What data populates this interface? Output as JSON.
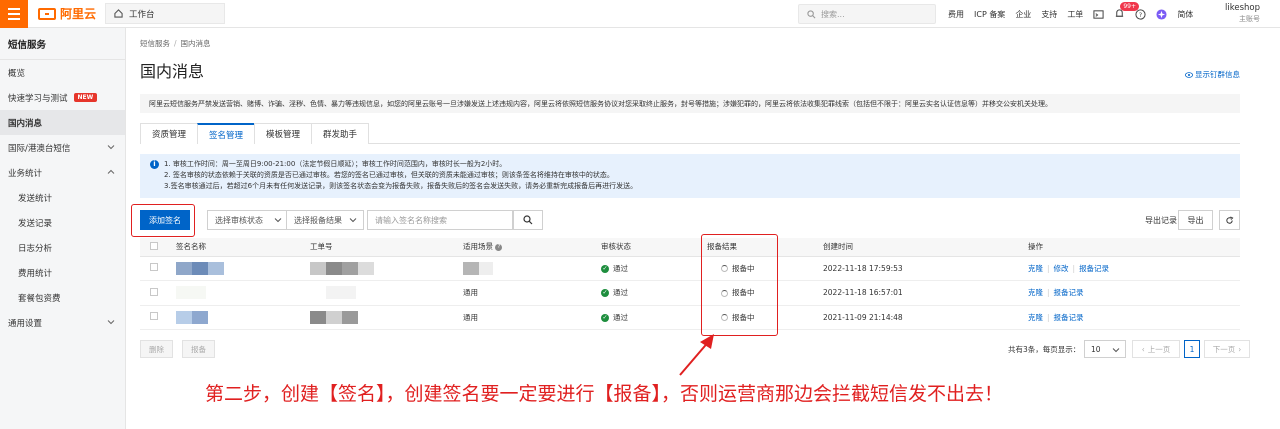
{
  "topbar": {
    "brand": "阿里云",
    "workbench": "工作台",
    "search_placeholder": "搜索...",
    "nav": [
      "费用",
      "ICP 备案",
      "企业",
      "支持",
      "工单"
    ],
    "notification_count": "99+",
    "language": "简体",
    "username": "likeshop",
    "account_type": "主账号"
  },
  "sidebar": {
    "title": "短信服务",
    "items": [
      {
        "label": "概览"
      },
      {
        "label": "快速学习与测试",
        "badge": "NEW"
      },
      {
        "label": "国内消息"
      },
      {
        "label": "国际/港澳台短信"
      },
      {
        "label": "业务统计"
      },
      {
        "label": "发送统计"
      },
      {
        "label": "发送记录"
      },
      {
        "label": "日志分析"
      },
      {
        "label": "费用统计"
      },
      {
        "label": "套餐包资费"
      },
      {
        "label": "通用设置"
      }
    ]
  },
  "breadcrumb": [
    "短信服务",
    "国内消息"
  ],
  "page_title": "国内消息",
  "help_link": "显示钉群信息",
  "notice": "阿里云短信服务严禁发送营销、赌博、诈骗、淫秽、色情、暴力等违规信息，如您的阿里云账号一旦涉嫌发送上述违规内容，阿里云将依照短信服务协议对您采取终止服务，封号等措施；涉嫌犯罪的，阿里云将依法收集犯罪线索（包括但不限于：阿里云实名认证信息等）并移交公安机关处理。",
  "tabs": [
    "资质管理",
    "签名管理",
    "模板管理",
    "群发助手"
  ],
  "info_lines": [
    "1. 审核工作时间：周一至周日9:00-21:00（法定节假日顺延）；审核工作时间范围内，审核时长一般为2小时。",
    "2. 签名审核的状态依赖于关联的资质是否已通过审核。若您的签名已通过审核，但关联的资质未能通过审核；则该条签名将维持在审核中的状态。",
    "3.签名审核通过后，若超过6个月未有任何发送记录，则该签名状态会变为报备失败，报备失败后的签名会发送失败，请务必重新完成报备后再进行发送。"
  ],
  "toolbar": {
    "add_button": "添加签名",
    "audit_filter": "选择审核状态",
    "report_filter": "选择报备结果",
    "search_placeholder": "请输入签名名称搜索",
    "export_records": "导出记录",
    "export_button": "导出"
  },
  "table": {
    "columns": [
      "签名名称",
      "工单号",
      "适用场景",
      "审核状态",
      "报备结果",
      "创建时间",
      "操作"
    ],
    "rows": [
      {
        "scene": "",
        "status": "通过",
        "report": "报备中",
        "created": "2022-11-18 17:59:53",
        "actions": [
          "克隆",
          "修改",
          "报备记录"
        ]
      },
      {
        "scene": "通用",
        "status": "通过",
        "report": "报备中",
        "created": "2022-11-18 16:57:01",
        "actions": [
          "克隆",
          "报备记录"
        ]
      },
      {
        "scene": "通用",
        "status": "通过",
        "report": "报备中",
        "created": "2021-11-09 21:14:48",
        "actions": [
          "克隆",
          "报备记录"
        ]
      }
    ]
  },
  "footer": {
    "delete_button": "删除",
    "report_button": "报备",
    "total_text": "共有3条，每页显示：",
    "page_size": "10",
    "prev": "上一页",
    "current_page": "1",
    "next": "下一页"
  },
  "annotation": "第二步，创建【签名】，创建签名要一定要进行【报备】，否则运营商那边会拦截短信发不出去！",
  "colors": {
    "brand": "#ff6a00",
    "primary": "#0064c8",
    "annotation": "#e02020",
    "success": "#1e8e3e"
  }
}
